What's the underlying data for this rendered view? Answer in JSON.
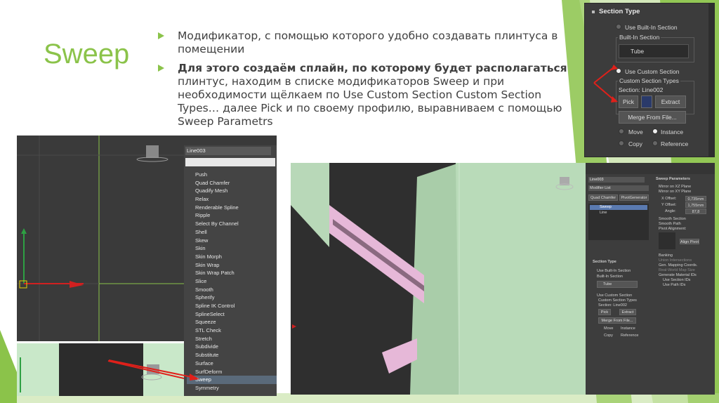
{
  "slide": {
    "title": "Sweep",
    "bullets": [
      {
        "text": "Модификатор, с помощью которого удобно создавать плинтуса в помещении",
        "bold_prefix": ""
      },
      {
        "bold_prefix": "Для этого создаём сплайн, по которому будет располагаться",
        "text": " плинтус, находим в списке модификаторов Sweep и при необходимости  щёлкаем по Use Custom Section Custom Section Types… далее Pick и по своему профилю, выравниваем с помощью Sweep Parametrs"
      }
    ],
    "accent_color": "#8bc34a"
  },
  "section_type_panel": {
    "header": "Section Type",
    "use_builtin": "Use Built-In Section",
    "builtin_group": "Built-In Section",
    "builtin_value": "Tube",
    "use_custom": "Use Custom Section",
    "custom_group": "Custom Section Types",
    "section_label": "Section: Line002",
    "pick": "Pick",
    "extract": "Extract",
    "merge": "Merge From File...",
    "move": "Move",
    "instance": "Instance",
    "copy": "Copy",
    "reference": "Reference"
  },
  "modifier_panel": {
    "object_name": "Line003",
    "items": [
      "Push",
      "Quad Chamfer",
      "Quadify Mesh",
      "Relax",
      "Renderable Spline",
      "Ripple",
      "Select By Channel",
      "Shell",
      "Skew",
      "Skin",
      "Skin Morph",
      "Skin Wrap",
      "Skin Wrap Patch",
      "Slice",
      "Smooth",
      "Spherify",
      "Spline IK Control",
      "SplineSelect",
      "Squeeze",
      "STL Check",
      "Stretch",
      "Subdivide",
      "Substitute",
      "Surface",
      "SurfDeform",
      "Sweep",
      "Symmetry"
    ],
    "selected": "Sweep"
  },
  "right_panel": {
    "object_name": "Line003",
    "modifier_list": "Modifier List",
    "quad_chamfer": "Quad Chamfer",
    "pivot_gen": "PivotGenerator",
    "stack": [
      "Sweep",
      "Line"
    ],
    "section_type": "Section Type",
    "use_builtin": "Use Built-In Section",
    "builtin_group": "Built-In Section",
    "tube": "Tube",
    "use_custom": "Use Custom Section",
    "custom_types": "Custom Section Types",
    "section": "Section: Line002",
    "pick": "Pick",
    "extract": "Extract",
    "merge": "Merge From File...",
    "move": "Move",
    "instance": "Instance",
    "copy": "Copy",
    "reference": "Reference",
    "sweep_params": "Sweep Parameters",
    "mirror_xz": "Mirror on XZ Plane",
    "mirror_xy": "Mirror on XY Plane",
    "x_offset_label": "X Offset:",
    "x_offset": "0,735mm",
    "y_offset_label": "Y Offset:",
    "y_offset": "1,755mm",
    "angle_label": "Angle:",
    "angle": "87,8",
    "smooth_section": "Smooth Section",
    "smooth_path": "Smooth Path",
    "pivot_alignment": "Pivot Alignment:",
    "align_pivot": "Align Pivot",
    "banking": "Banking",
    "union": "Union Intersections",
    "gen_map": "Gen. Mapping Coords.",
    "real_world": "Real-World Map Size",
    "gen_mat": "Generate Material IDs",
    "use_section_ids": "Use Section IDs",
    "use_path_ids": "Use Path IDs"
  }
}
